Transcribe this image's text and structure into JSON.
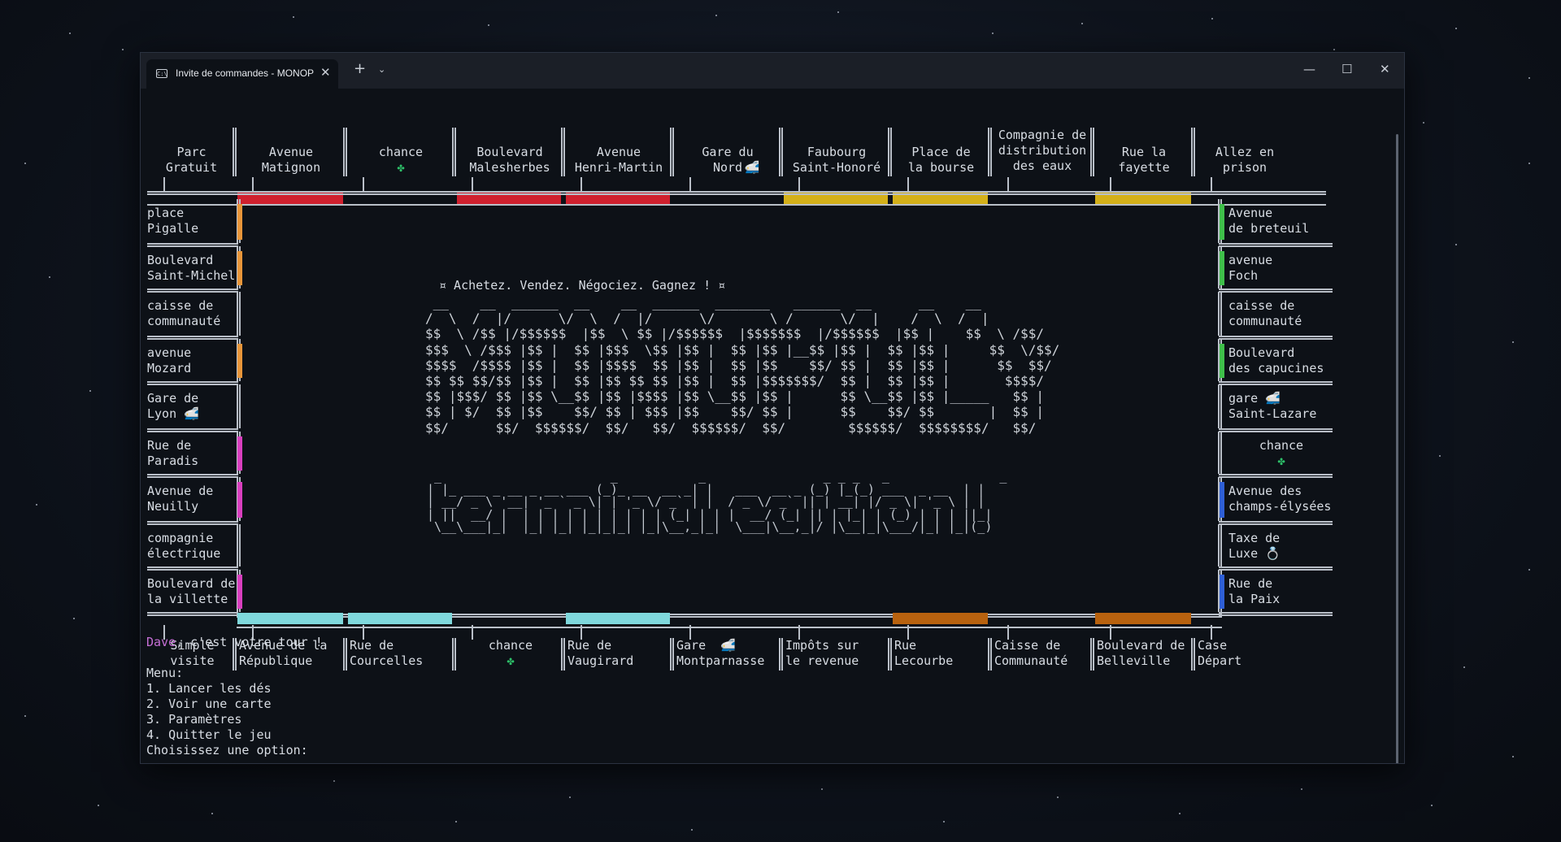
{
  "window": {
    "tab_title": "Invite de commandes - MONOPOLY",
    "tab_icon": "terminal-icon",
    "controls": {
      "minimize": "—",
      "maximize": "☐",
      "close": "✕",
      "new_tab": "+",
      "dropdown": "⌄",
      "tab_close": "✕"
    }
  },
  "board": {
    "top": [
      {
        "name": "Parc\nGratuit",
        "icon": ""
      },
      {
        "name": "Avenue\nMatignon",
        "icon": "",
        "color": "#d0202e"
      },
      {
        "name": "chance",
        "icon": "✤",
        "icon_name": "clover-icon"
      },
      {
        "name": "Boulevard\nMalesherbes",
        "icon": "",
        "color": "#d0202e"
      },
      {
        "name": "Avenue\nHenri-Martin",
        "icon": "",
        "color": "#d0202e"
      },
      {
        "name": "Gare du\nNord",
        "icon": "🚅",
        "icon_name": "train-icon"
      },
      {
        "name": "Faubourg\nSaint-Honoré",
        "icon": "",
        "color": "#d4b019"
      },
      {
        "name": "Place de\nla bourse",
        "icon": "",
        "color": "#d4b019"
      },
      {
        "name": "Compagnie de\ndistribution\ndes eaux",
        "icon": ""
      },
      {
        "name": "Rue la\nfayette",
        "icon": "",
        "color": "#d4b019"
      },
      {
        "name": "Allez en\nprison",
        "icon": ""
      }
    ],
    "left": [
      {
        "name": "place\nPigalle",
        "color": "#e8963a"
      },
      {
        "name": "Boulevard\nSaint-Michel",
        "color": "#e8963a"
      },
      {
        "name": "caisse de\ncommunauté"
      },
      {
        "name": "avenue\nMozard",
        "color": "#e8963a"
      },
      {
        "name": "Gare de\nLyon 🚅"
      },
      {
        "name": "Rue de\nParadis",
        "color": "#d93fbf"
      },
      {
        "name": "Avenue de\nNeuilly",
        "color": "#d93fbf"
      },
      {
        "name": "compagnie\nélectrique"
      },
      {
        "name": "Boulevard de\nla villette",
        "color": "#d93fbf"
      }
    ],
    "right": [
      {
        "name": "Avenue\nde breteuil",
        "color": "#3fbf4a"
      },
      {
        "name": "avenue\nFoch",
        "color": "#3fbf4a"
      },
      {
        "name": "caisse de\ncommunauté"
      },
      {
        "name": "Boulevard\ndes capucines",
        "color": "#3fbf4a"
      },
      {
        "name": "gare 🚅\nSaint-Lazare"
      },
      {
        "name": "chance\n✤"
      },
      {
        "name": "Avenue des\nchamps-élysées",
        "color": "#2f5fd6"
      },
      {
        "name": "Taxe de\nLuxe 💍"
      },
      {
        "name": "Rue de\nla Paix",
        "color": "#2f5fd6"
      }
    ],
    "bottom": [
      {
        "name": "Simple\nvisite"
      },
      {
        "name": "Avenue de la\nRépublique",
        "color": "#7fd8dc"
      },
      {
        "name": "Rue de\nCourcelles",
        "color": "#7fd8dc"
      },
      {
        "name": "chance\n✤"
      },
      {
        "name": "Rue de\nVaugirard",
        "color": "#7fd8dc"
      },
      {
        "name": "Gare  🚅\nMontparnasse"
      },
      {
        "name": "Impôts sur\nle revenue"
      },
      {
        "name": "Rue\nLecourbe",
        "color": "#b8620f"
      },
      {
        "name": "Caisse de\nCommunauté"
      },
      {
        "name": "Boulevard de\nBelleville",
        "color": "#b8620f"
      },
      {
        "name": "Case\nDépart"
      }
    ]
  },
  "center": {
    "slogan": "¤ Achetez. Vendez. Négociez. Gagnez ! ¤",
    "logo": " __    __  ______  __    __  ______  _______   ______  __      __    __ \n/  \\  /  |/      \\/  \\  /  |/      \\/       \\ /      \\/  |    /  \\  /  |\n$$  \\ /$$ |/$$$$$$  |$$  \\ $$ |/$$$$$$  |$$$$$$$  |/$$$$$$  |$$ |    $$  \\ /$$/\n$$$  \\ /$$$ |$$ |  $$ |$$$  \\$$ |$$ |  $$ |$$ |__$$ |$$ |  $$ |$$ |     $$  \\/$$/ \n$$$$  /$$$$ |$$ |  $$ |$$$$  $$ |$$ |  $$ |$$    $$/ $$ |  $$ |$$ |      $$  $$/  \n$$ $$ $$/$$ |$$ |  $$ |$$ $$ $$ |$$ |  $$ |$$$$$$$/  $$ |  $$ |$$ |       $$$$/   \n$$ |$$$/ $$ |$$ \\__$$ |$$ |$$$$ |$$ \\__$$ |$$ |      $$ \\__$$ |$$ |_____   $$ |    \n$$ | $/  $$ |$$    $$/ $$ | $$$ |$$    $$/ $$ |      $$    $$/ $$       |  $$ |    \n$$/      $$/  $$$$$$/  $$/   $$/  $$$$$$/  $$/        $$$$$$/  $$$$$$$$/   $$/     ",
    "sublogo": " _                       _           _                _ _ _   _               _\n| |_ ___ _ __ _ __ ___ (_)_ __  __ _| |   ___  __ _ (_) |_(_) ___  _ __  | |\n| __/ _ \\ '__| '_ ` _ \\| | '_ \\/ _` | |  / _ \\/ _` || | __| |/ _ \\| '_ \\ | |\n| ||  __/ |  | | | | | | | | | | (_| | | |  __/ (_| || | |_| | (_) | | | ||_|\n \\__\\___|_|  |_| |_| |_|_|_| |_|\\__,_|_|  \\___|\\__,_|/ |\\__|_|\\___/|_| |_|(_)"
  },
  "prompt": {
    "player": "Dave",
    "turn_text": ", c'est votre tour !",
    "menu_title": "Menu:",
    "options": [
      "1. Lancer les dés",
      "2. Voir une carte",
      "3. Paramètres",
      "4. Quitter le jeu"
    ],
    "choose": "Choisissez une option:"
  },
  "colors": {
    "player": "#c66fd6",
    "terminal_bg": "#0d1117",
    "text": "#d8dde4"
  }
}
